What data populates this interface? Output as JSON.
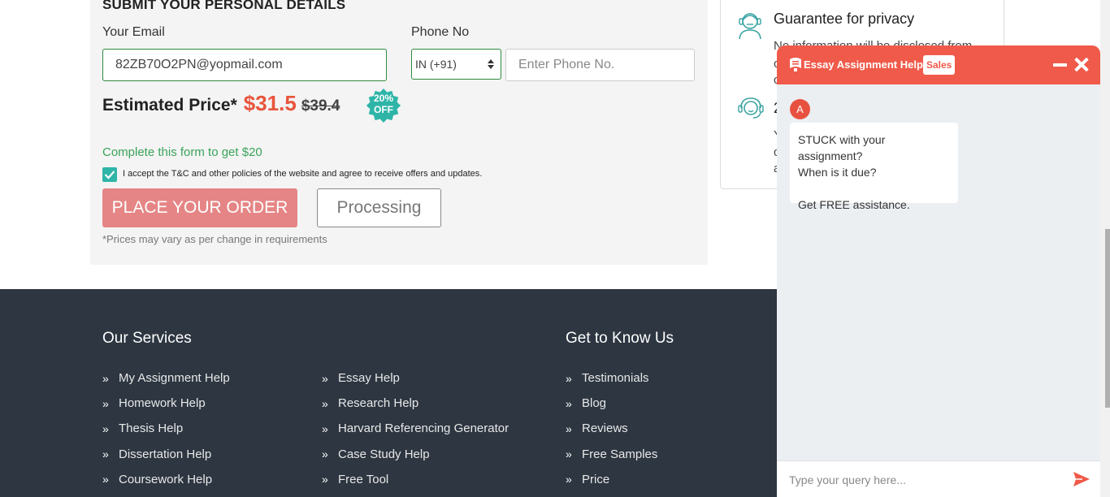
{
  "form": {
    "title": "SUBMIT YOUR PERSONAL DETAILS",
    "email_label": "Your Email",
    "email_value": "82ZB70O2PN@yopmail.com",
    "phone_label": "Phone No",
    "country_code": "IN (+91)",
    "phone_placeholder": "Enter Phone No.",
    "price_label": "Estimated Price*",
    "price_new": "$31.5",
    "price_old": "$39.4",
    "badge_line1": "20%",
    "badge_line2": "OFF",
    "complete_text": "Complete this form to get $20",
    "tc_checked": true,
    "tc_text": "I accept the T&C and other policies of the website and agree to receive offers and updates.",
    "order_button": "PLACE YOUR ORDER",
    "processing_button": "Processing",
    "note": "*Prices may vary as per change in requirements",
    "accent_color": "#e8553c",
    "badge_color": "#2eb5a8"
  },
  "side": {
    "item1_icon": "privacy-person-icon",
    "item1_title": "Guarantee for privacy",
    "item1_text": "No information will be disclosed from",
    "item1_frag1": "c",
    "item1_frag2": "c",
    "item2_icon": "support-agent-icon",
    "item2_title": "2",
    "item2_frag1": "Y",
    "item2_frag2": "c",
    "item2_frag3": "a"
  },
  "footer": {
    "services_heading": "Our Services",
    "services_col1": [
      "My Assignment Help",
      "Homework Help",
      "Thesis Help",
      "Dissertation Help",
      "Coursework Help"
    ],
    "services_col2": [
      "Essay Help",
      "Research Help",
      "Harvard Referencing Generator",
      "Case Study Help",
      "Free Tool"
    ],
    "know_heading": "Get to Know Us",
    "know_list": [
      "Testimonials",
      "Blog",
      "Reviews",
      "Free Samples",
      "Price"
    ],
    "background": "#2d3641"
  },
  "chat": {
    "brand": "Essay Assignment Help",
    "tag": "Sales",
    "avatar_letter": "A",
    "message_lines": [
      "STUCK with your assignment?",
      "When is it due?",
      "",
      "Get FREE assistance."
    ],
    "input_placeholder": "Type your query here...",
    "header_color": "#f05a4a"
  }
}
